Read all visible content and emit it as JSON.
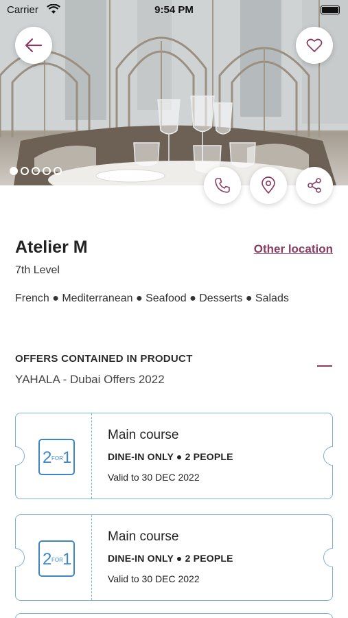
{
  "status_bar": {
    "carrier": "Carrier",
    "time": "9:54 PM"
  },
  "hero": {
    "carousel": {
      "count": 5,
      "active_index": 0
    },
    "icons": {
      "back": "arrow-left-icon",
      "favorite": "heart-icon",
      "call": "phone-icon",
      "map": "location-pin-icon",
      "share": "share-icon"
    }
  },
  "restaurant": {
    "name": "Atelier M",
    "other_location_label": "Other location",
    "level": "7th Level",
    "cuisines": "French ● Mediterranean ● Seafood ● Desserts ● Salads"
  },
  "offers": {
    "heading": "OFFERS CONTAINED IN PRODUCT",
    "product": "YAHALA - Dubai Offers 2022",
    "items": [
      {
        "badge_text": "2FOR1",
        "title": "Main course",
        "type": "DINE-IN ONLY ● 2 PEOPLE",
        "validity": "Valid to 30 DEC 2022"
      },
      {
        "badge_text": "2FOR1",
        "title": "Main course",
        "type": "DINE-IN ONLY ● 2 PEOPLE",
        "validity": "Valid to 30 DEC 2022"
      }
    ]
  },
  "colors": {
    "accent": "#8a3d62",
    "coupon_border": "#7fb0d8",
    "badge_blue": "#3d86c6"
  }
}
